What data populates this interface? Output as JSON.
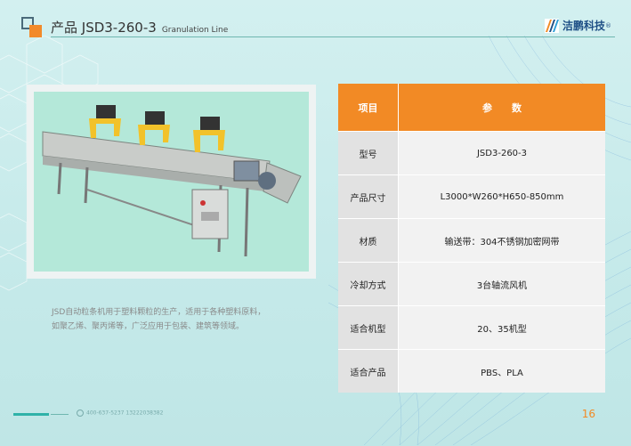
{
  "header": {
    "title": "产品 JSD3-260-3",
    "subtitle": "Granulation Line",
    "brand_name": "洁鹏科技",
    "brand_reg": "®"
  },
  "colors": {
    "accent_orange": "#f28a25",
    "brand_blue": "#1e4f86",
    "teal_line": "#6fb7b0"
  },
  "description": "JSD自动粒条机用于塑料颗粒的生产，适用于各种塑料原料，如聚乙烯、聚丙烯等，广泛应用于包装、建筑等领域。",
  "spec_table": {
    "header_key": "项目",
    "header_value": "参　　数",
    "rows": [
      {
        "k": "型号",
        "v": "JSD3-260-3"
      },
      {
        "k": "产品尺寸",
        "v": "L3000*W260*H650-850mm"
      },
      {
        "k": "材质",
        "v": "输送带：304不锈钢加密网带"
      },
      {
        "k": "冷却方式",
        "v": "3台轴流风机"
      },
      {
        "k": "适合机型",
        "v": "20、35机型"
      },
      {
        "k": "适合产品",
        "v": "PBS、PLA"
      }
    ]
  },
  "footer": {
    "phone": "400-637-5237  13222038382",
    "page_number": "16"
  }
}
